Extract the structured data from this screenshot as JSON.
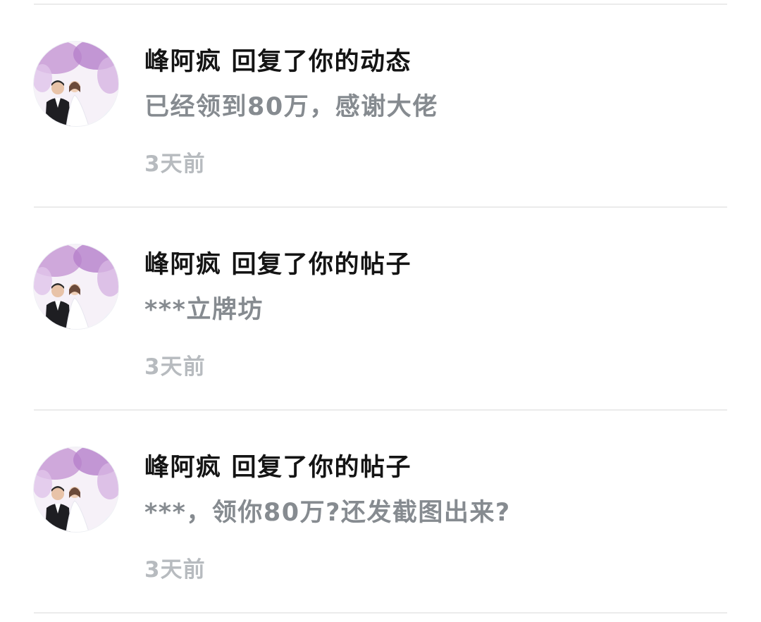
{
  "notifications": [
    {
      "user": "峰阿疯",
      "action": "回复了你的动态",
      "content": "已经领到80万，感谢大佬",
      "time": "3天前"
    },
    {
      "user": "峰阿疯",
      "action": "回复了你的帖子",
      "content": "***立牌坊",
      "time": "3天前"
    },
    {
      "user": "峰阿疯",
      "action": "回复了你的帖子",
      "content": "***，领你80万?还发截图出来?",
      "time": "3天前"
    }
  ],
  "colors": {
    "title": "#141414",
    "content": "#868b90",
    "time": "#b7bbbf",
    "divider": "#ebebeb"
  },
  "icons": {
    "avatar": "wedding-photo-avatar-icon"
  }
}
